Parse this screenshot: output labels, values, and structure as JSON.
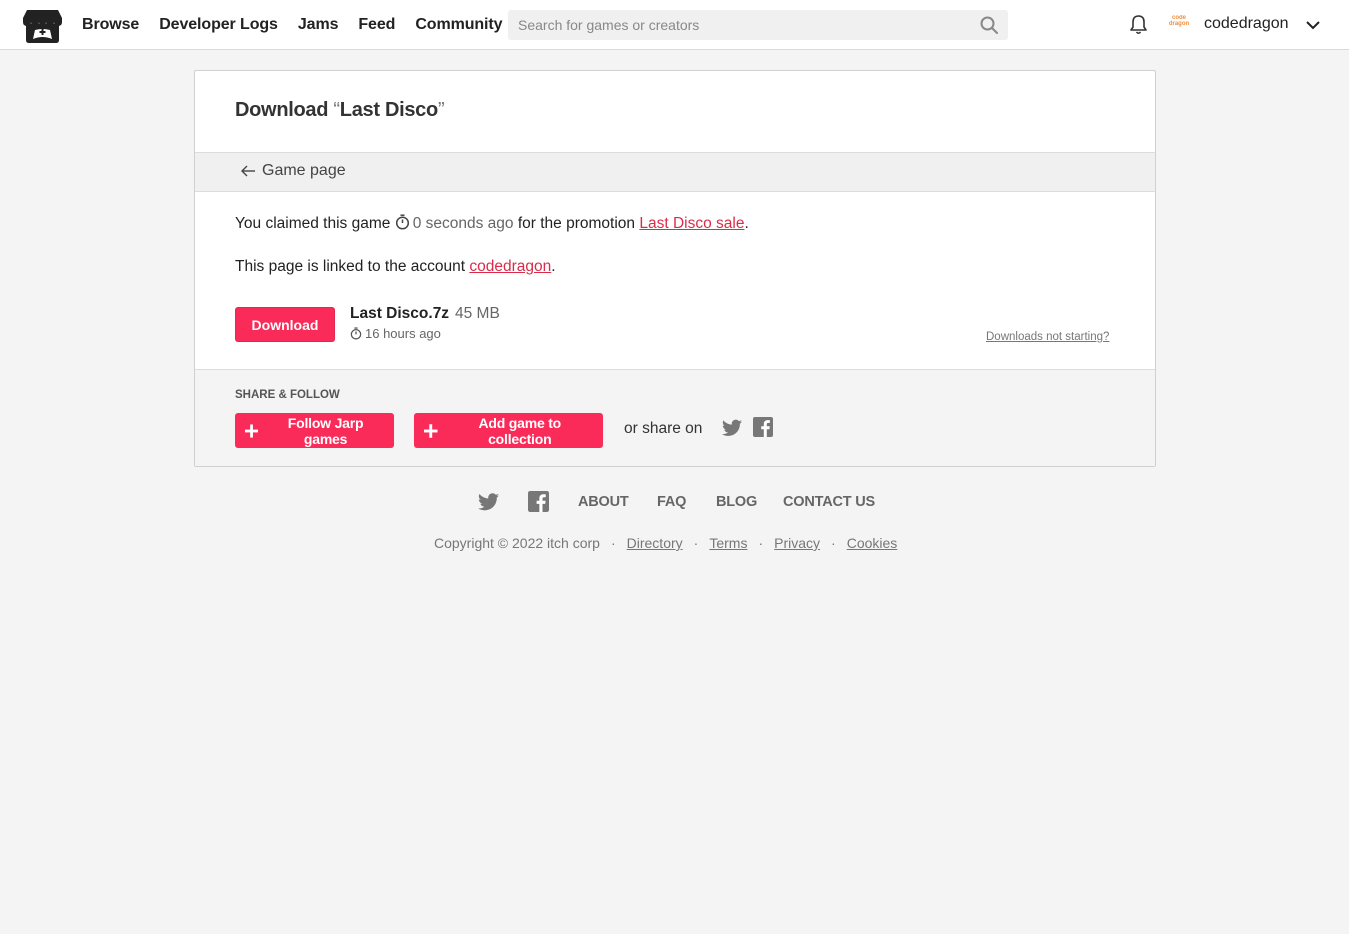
{
  "header": {
    "nav": [
      "Browse",
      "Developer Logs",
      "Jams",
      "Feed",
      "Community"
    ],
    "search_placeholder": "Search for games or creators",
    "avatar_text": "code\ndragon",
    "username": "codedragon"
  },
  "page": {
    "title_prefix": "Download ",
    "open_quote": "“",
    "game_title": "Last Disco",
    "close_quote": "”",
    "back_label": "Game page",
    "claimed_text": "You claimed this game",
    "claimed_time": "0 seconds ago",
    "promotion_text": "for the promotion",
    "promotion_link": "Last Disco sale",
    "linked_text": "This page is linked to the account",
    "account_link": "codedragon",
    "period": "."
  },
  "download": {
    "button_label": "Download",
    "file_name": "Last Disco.7z",
    "file_size": "45 MB",
    "file_time": "16 hours ago",
    "not_starting": "Downloads not starting?"
  },
  "share": {
    "heading": "SHARE & FOLLOW",
    "follow_label": "Follow Jarp games",
    "collection_label": "Add game to collection",
    "share_on": "or share on"
  },
  "footer": {
    "links": [
      "ABOUT",
      "FAQ",
      "BLOG",
      "CONTACT US"
    ],
    "copyright": "Copyright © 2022 itch corp",
    "sub_links": [
      "Directory",
      "Terms",
      "Privacy",
      "Cookies"
    ],
    "separator": "·"
  },
  "colors": {
    "accent": "#fa2b58",
    "link": "#da2c49",
    "background": "#f4f4f4"
  }
}
